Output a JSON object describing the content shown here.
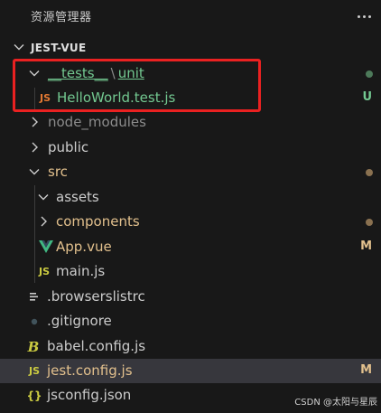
{
  "header": {
    "title": "资源管理器",
    "more_icon": "ellipsis-icon"
  },
  "project": {
    "title": "JEST-VUE"
  },
  "tree": [
    {
      "kind": "folder-open",
      "path_parts": [
        "__tests__",
        "unit"
      ],
      "color": "#73c991",
      "status_dot": "#4d7a5a"
    },
    {
      "kind": "file",
      "label": "HelloWorld.test.js",
      "icon": "JS",
      "icon_color": "#e37933",
      "color": "#73c991",
      "status": "U",
      "status_color": "#73c991"
    },
    {
      "kind": "folder-closed",
      "label": "node_modules",
      "color": "#8c8c8c"
    },
    {
      "kind": "folder-closed",
      "label": "public",
      "color": "#cccccc"
    },
    {
      "kind": "folder-open",
      "label": "src",
      "color": "#e2c08d",
      "status_dot": "#8a7150"
    },
    {
      "kind": "folder-open",
      "label": "assets",
      "color": "#cccccc"
    },
    {
      "kind": "folder-closed",
      "label": "components",
      "color": "#e2c08d",
      "status_dot": "#8a7150"
    },
    {
      "kind": "file",
      "label": "App.vue",
      "icon": "vue-icon",
      "icon_color": "#41b883",
      "color": "#e2c08d",
      "status": "M",
      "status_color": "#e2c08d"
    },
    {
      "kind": "file",
      "label": "main.js",
      "icon": "JS",
      "icon_color": "#cbcb41",
      "color": "#cccccc"
    },
    {
      "kind": "file",
      "label": ".browserslistrc",
      "icon": "lines-icon",
      "icon_color": "#cccccc",
      "color": "#cccccc"
    },
    {
      "kind": "file",
      "label": ".gitignore",
      "icon": "git-dot-icon",
      "icon_color": "#41535b",
      "color": "#cccccc"
    },
    {
      "kind": "file",
      "label": "babel.config.js",
      "icon": "babel-icon",
      "icon_color": "#cbcb41",
      "color": "#cccccc"
    },
    {
      "kind": "file",
      "label": "jest.config.js",
      "icon": "JS",
      "icon_color": "#cbcb41",
      "color": "#e2c08d",
      "status": "M",
      "status_color": "#e2c08d",
      "selected": true
    },
    {
      "kind": "file",
      "label": "jsconfig.json",
      "icon": "{}",
      "icon_color": "#cbcb41",
      "color": "#cccccc"
    }
  ],
  "watermark": "CSDN @太阳与星辰"
}
